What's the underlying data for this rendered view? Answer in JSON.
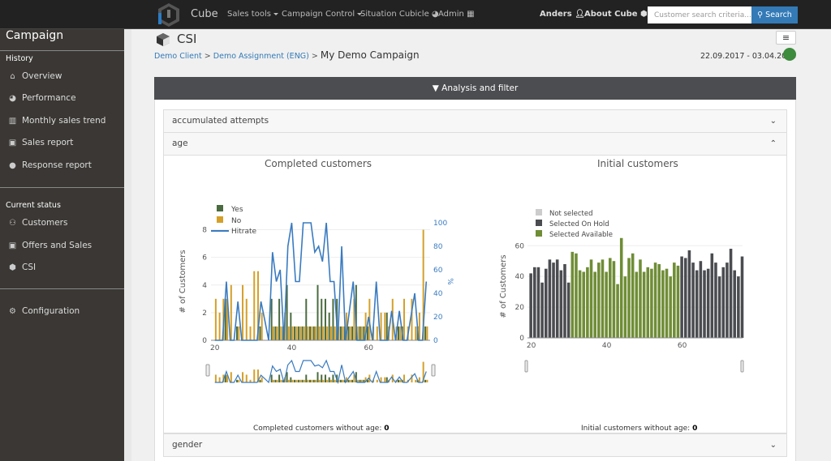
{
  "topbar": {
    "brand": "Cube",
    "nav": [
      {
        "label": "Sales tools",
        "dropdown": true
      },
      {
        "label": "Campaign Control",
        "dropdown": true
      },
      {
        "label": "Situation Cubicle",
        "icon": "dashboard-icon"
      },
      {
        "label": "Admin",
        "icon": "grid-icon"
      }
    ],
    "user": "Anders",
    "about": "About Cube",
    "search_placeholder": "Customer search criteria...",
    "search_label": "Search"
  },
  "sidebar": {
    "title": "Campaign",
    "sections": [
      {
        "label": "History",
        "items": [
          {
            "label": "Overview",
            "icon": "home-icon"
          },
          {
            "label": "Performance",
            "icon": "dashboard-icon"
          },
          {
            "label": "Monthly sales trend",
            "icon": "bar-chart-icon"
          },
          {
            "label": "Sales report",
            "icon": "gift-icon"
          },
          {
            "label": "Response report",
            "icon": "comments-icon"
          }
        ]
      },
      {
        "label": "Current status",
        "items": [
          {
            "label": "Customers",
            "icon": "users-icon"
          },
          {
            "label": "Offers and Sales",
            "icon": "gift-icon"
          },
          {
            "label": "CSI",
            "icon": "cube-icon"
          }
        ]
      }
    ],
    "config": {
      "label": "Configuration",
      "icon": "gears-icon"
    }
  },
  "header": {
    "title": "CSI",
    "breadcrumb": [
      "Demo Client",
      "Demo Assignment (ENG)",
      "My Demo Campaign"
    ],
    "separator": ">",
    "date_range": "22.09.2017 - 03.04.2020",
    "status_color": "#3d8b3d"
  },
  "filter_bar": {
    "label": "Analysis and filter"
  },
  "accordions": [
    {
      "label": "accumulated attempts",
      "expanded": false
    },
    {
      "label": "age",
      "expanded": true
    },
    {
      "label": "gender",
      "expanded": false
    }
  ],
  "footnotes": {
    "completed_label": "Completed customers without age:",
    "completed_value": "0",
    "initial_label": "Initial customers without age:",
    "initial_value": "0"
  },
  "chart_data": [
    {
      "type": "bar",
      "title": "Completed customers",
      "xlabel": "",
      "ylabel": "# of Customers",
      "y2label": "%",
      "xlim": [
        19,
        76
      ],
      "ylim": [
        0,
        8.5
      ],
      "y2lim": [
        0,
        100
      ],
      "xticks": [
        20,
        40,
        60
      ],
      "yticks": [
        0,
        2,
        4,
        6,
        8
      ],
      "y2ticks": [
        0,
        20,
        40,
        60,
        80,
        100
      ],
      "legend": "top-left",
      "colors": {
        "Yes": "#4a6b3f",
        "No": "#d4a02a",
        "Hitrate": "#3a7bc0"
      },
      "x": [
        20,
        21,
        22,
        23,
        24,
        25,
        26,
        27,
        28,
        29,
        30,
        31,
        32,
        33,
        34,
        35,
        36,
        37,
        38,
        39,
        40,
        41,
        42,
        43,
        44,
        45,
        46,
        47,
        48,
        49,
        50,
        51,
        52,
        53,
        54,
        55,
        56,
        57,
        58,
        59,
        60,
        61,
        62,
        63,
        64,
        65,
        66,
        67,
        68,
        69,
        70,
        71,
        72,
        73,
        74,
        75
      ],
      "series": [
        {
          "name": "Yes",
          "values": [
            0,
            0,
            0,
            3,
            0,
            0,
            1,
            0,
            0,
            0,
            0,
            0,
            1,
            0,
            0,
            3,
            1,
            3,
            1,
            4,
            2,
            1,
            1,
            1,
            3,
            1,
            1,
            4,
            3,
            3,
            2,
            3,
            3,
            1,
            1,
            1,
            1,
            4,
            1,
            1,
            1,
            0,
            0,
            0,
            0,
            2,
            0,
            0,
            1,
            1,
            0,
            0,
            0,
            1,
            0,
            1
          ]
        },
        {
          "name": "No",
          "values": [
            3,
            2,
            3,
            3,
            4,
            0,
            1,
            4,
            3,
            1,
            5,
            5,
            2,
            0,
            0,
            1,
            1,
            1,
            2,
            1,
            1,
            1,
            1,
            1,
            1,
            1,
            1,
            1,
            1,
            1,
            1,
            1,
            1,
            1,
            2,
            1,
            3,
            1,
            1,
            2,
            3,
            1,
            1,
            2,
            2,
            1,
            3,
            1,
            1,
            3,
            1,
            3,
            1,
            2,
            8,
            1
          ]
        },
        {
          "name": "Hitrate",
          "values": [
            0,
            0,
            0,
            50,
            0,
            0,
            33,
            0,
            0,
            0,
            0,
            0,
            33,
            17,
            0,
            75,
            50,
            60,
            0,
            80,
            100,
            50,
            50,
            100,
            100,
            100,
            75,
            80,
            67,
            100,
            50,
            50,
            0,
            80,
            0,
            25,
            50,
            0,
            0,
            0,
            20,
            0,
            50,
            0,
            0,
            0,
            25,
            0,
            25,
            0,
            0,
            20,
            40,
            0,
            0,
            50
          ]
        }
      ]
    },
    {
      "type": "bar",
      "title": "Initial customers",
      "xlabel": "",
      "ylabel": "# of Customers",
      "xlim": [
        19,
        76
      ],
      "ylim": [
        0,
        67
      ],
      "xticks": [
        20,
        40,
        60
      ],
      "yticks": [
        0,
        20,
        40,
        60
      ],
      "legend": "top-left",
      "legend_entries": [
        "Not selected",
        "Selected On Hold",
        "Selected Available"
      ],
      "colors": {
        "Not selected": "#cccccc",
        "Selected On Hold": "#4a4c50",
        "Selected Available": "#6f8d36"
      },
      "x": [
        20,
        21,
        22,
        23,
        24,
        25,
        26,
        27,
        28,
        29,
        30,
        31,
        32,
        33,
        34,
        35,
        36,
        37,
        38,
        39,
        40,
        41,
        42,
        43,
        44,
        45,
        46,
        47,
        48,
        49,
        50,
        51,
        52,
        53,
        54,
        55,
        56,
        57,
        58,
        59,
        60,
        61,
        62,
        63,
        64,
        65,
        66,
        67,
        68,
        69,
        70,
        71,
        72,
        73,
        74,
        75,
        76
      ],
      "values": [
        42,
        46,
        46,
        36,
        45,
        51,
        49,
        51,
        44,
        48,
        36,
        56,
        55,
        44,
        43,
        46,
        51,
        43,
        49,
        51,
        43,
        52,
        50,
        35,
        65,
        40,
        52,
        55,
        43,
        51,
        43,
        46,
        45,
        49,
        48,
        44,
        45,
        40,
        49,
        47,
        53,
        52,
        57,
        49,
        44,
        50,
        44,
        45,
        55,
        49,
        40,
        46,
        49,
        58,
        44,
        40,
        53
      ],
      "category": [
        "Selected On Hold",
        "Selected On Hold",
        "Selected On Hold",
        "Selected On Hold",
        "Selected On Hold",
        "Selected On Hold",
        "Selected On Hold",
        "Selected On Hold",
        "Selected On Hold",
        "Selected On Hold",
        "Selected On Hold",
        "Selected Available",
        "Selected Available",
        "Selected Available",
        "Selected Available",
        "Selected Available",
        "Selected Available",
        "Selected Available",
        "Selected Available",
        "Selected Available",
        "Selected Available",
        "Selected Available",
        "Selected Available",
        "Selected Available",
        "Selected Available",
        "Selected Available",
        "Selected Available",
        "Selected Available",
        "Selected Available",
        "Selected Available",
        "Selected Available",
        "Selected Available",
        "Selected Available",
        "Selected Available",
        "Selected Available",
        "Selected Available",
        "Selected Available",
        "Selected Available",
        "Selected Available",
        "Selected Available",
        "Selected On Hold",
        "Selected On Hold",
        "Selected On Hold",
        "Selected On Hold",
        "Selected On Hold",
        "Selected On Hold",
        "Selected On Hold",
        "Selected On Hold",
        "Selected On Hold",
        "Selected On Hold",
        "Selected On Hold",
        "Selected On Hold",
        "Selected On Hold",
        "Selected On Hold",
        "Selected On Hold",
        "Selected On Hold",
        "Selected On Hold"
      ]
    }
  ]
}
